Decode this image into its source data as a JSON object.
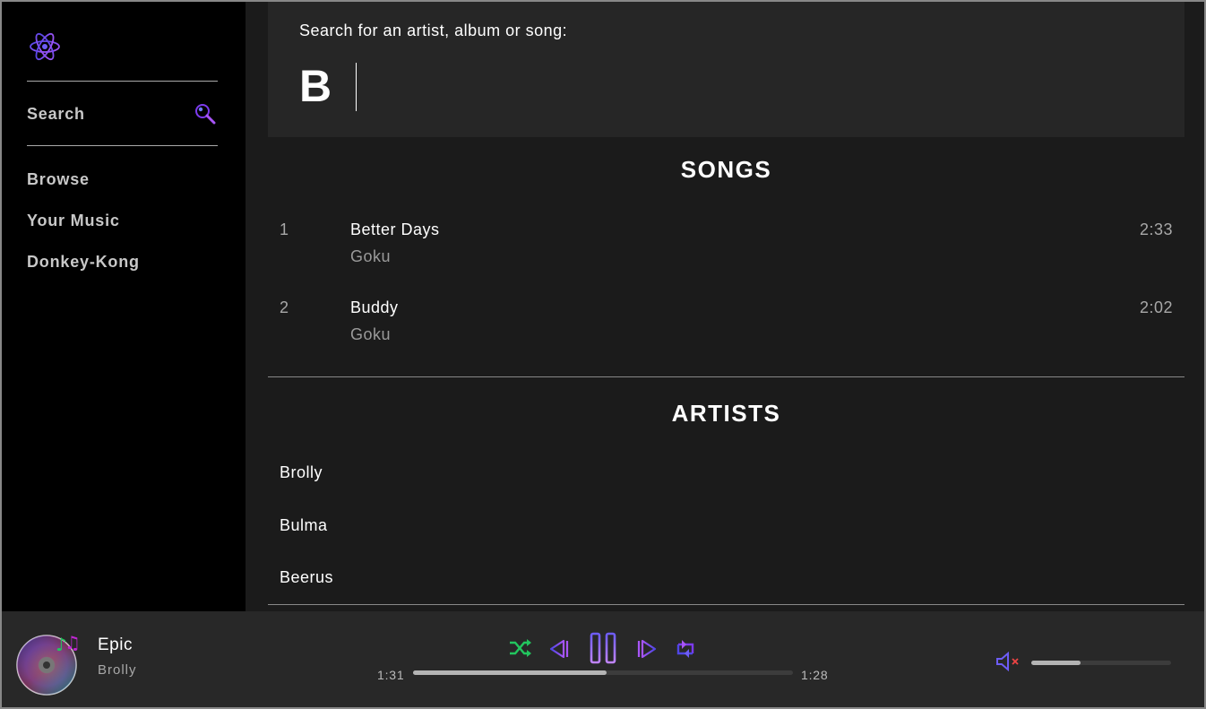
{
  "sidebar": {
    "search_label": "Search",
    "items": [
      {
        "label": "Browse"
      },
      {
        "label": "Your Music"
      },
      {
        "label": "Donkey-Kong"
      }
    ]
  },
  "search": {
    "prompt": "Search for an artist, album or song:",
    "value": "B"
  },
  "songs": {
    "title": "SONGS",
    "rows": [
      {
        "num": "1",
        "title": "Better Days",
        "artist": "Goku",
        "duration": "2:33"
      },
      {
        "num": "2",
        "title": "Buddy",
        "artist": "Goku",
        "duration": "2:02"
      }
    ]
  },
  "artists": {
    "title": "ARTISTS",
    "rows": [
      {
        "name": "Brolly"
      },
      {
        "name": "Bulma"
      },
      {
        "name": "Beerus"
      }
    ]
  },
  "player": {
    "track_title": "Epic",
    "track_artist": "Brolly",
    "elapsed": "1:31",
    "remaining": "1:28",
    "progress_fraction": 0.51,
    "volume_fraction": 0.35,
    "muted": true
  },
  "icons": {
    "logo": "atom-icon",
    "search": "magnifier-icon",
    "shuffle": "shuffle-icon",
    "previous": "previous-icon",
    "pause": "pause-icon",
    "next": "next-icon",
    "repeat": "repeat-icon",
    "volume": "speaker-muted-icon",
    "album": "disc-icon"
  },
  "colors": {
    "accent_purple": "#8b5cf6",
    "accent_blue": "#4f46e5",
    "shuffle_green": "#22c55e",
    "sidebar_bg": "#000000",
    "main_bg": "#1b1b1b",
    "player_bg": "#282828"
  }
}
